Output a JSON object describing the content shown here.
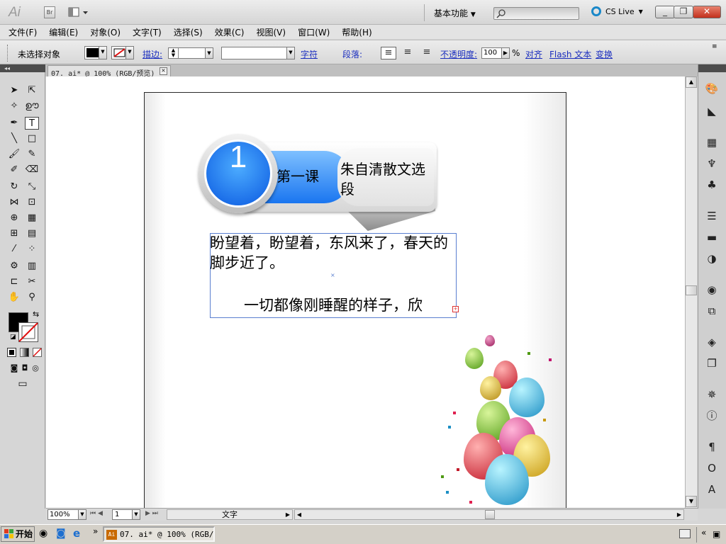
{
  "titlebar": {
    "app_logo": "Ai",
    "bridge_button": "Br",
    "workspace_label": "基本功能",
    "cs_live_label": "CS Live",
    "min_label": "_",
    "restore_label": "❐",
    "close_label": "✕"
  },
  "menu": {
    "items": [
      "文件(F)",
      "编辑(E)",
      "对象(O)",
      "文字(T)",
      "选择(S)",
      "效果(C)",
      "视图(V)",
      "窗口(W)",
      "帮助(H)"
    ]
  },
  "control_bar": {
    "selection_status": "未选择对象",
    "stroke_label": "描边:",
    "character_link": "字符",
    "paragraph_label": "段落:",
    "opacity_label": "不透明度:",
    "opacity_value": "100",
    "opacity_unit": "%",
    "align_link": "对齐",
    "flash_text_link": "Flash 文本",
    "transform_link": "变换"
  },
  "document_tab": {
    "title": "07. ai* @ 100% (RGB/预览)",
    "close_label": "✕"
  },
  "status_bar": {
    "zoom_value": "100%",
    "artboard_number": "1",
    "status_text": "文字"
  },
  "artboard_content": {
    "badge_number": "1",
    "lesson_label": "第一课",
    "lesson_title": "朱自清散文选段",
    "paragraph_1": "盼望着，盼望着，东风来了，春天的脚步近了。",
    "paragraph_2": "一切都像刚睡醒的样子，欣"
  },
  "taskbar": {
    "start_label": "开始",
    "task_label": "07. ai* @ 100% (RGB/...",
    "quick_launch_more": "»",
    "tray_expand": "«"
  },
  "colors": {
    "badge_blue": "#0a58e0",
    "text_frame_border": "#5a7fd0",
    "link_blue": "#1c2fbf",
    "close_red": "#c2301c"
  }
}
